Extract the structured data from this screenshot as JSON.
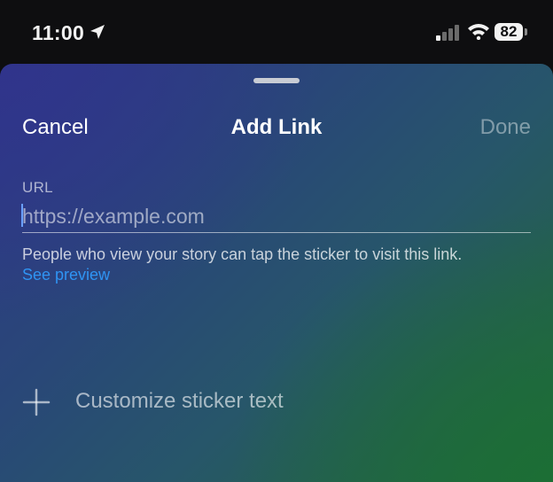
{
  "status_bar": {
    "time": "11:00",
    "battery": "82",
    "icons": [
      "location-arrow-icon",
      "cellular-signal-icon",
      "wifi-icon",
      "battery-icon"
    ]
  },
  "sheet": {
    "cancel_label": "Cancel",
    "title": "Add Link",
    "done_label": "Done",
    "url_label": "URL",
    "url_value": "",
    "url_placeholder": "https://example.com",
    "helper_text": "People who view your story can tap the sticker to visit this link.",
    "preview_link": "See preview",
    "customize_label": "Customize sticker text",
    "customize_icon": "plus-icon"
  },
  "colors": {
    "link_blue": "#2f94f3",
    "gradient_top_left": "#2e3886",
    "gradient_bottom_right": "#1f6a3e",
    "done_disabled": "rgba(255,255,255,0.42)"
  }
}
